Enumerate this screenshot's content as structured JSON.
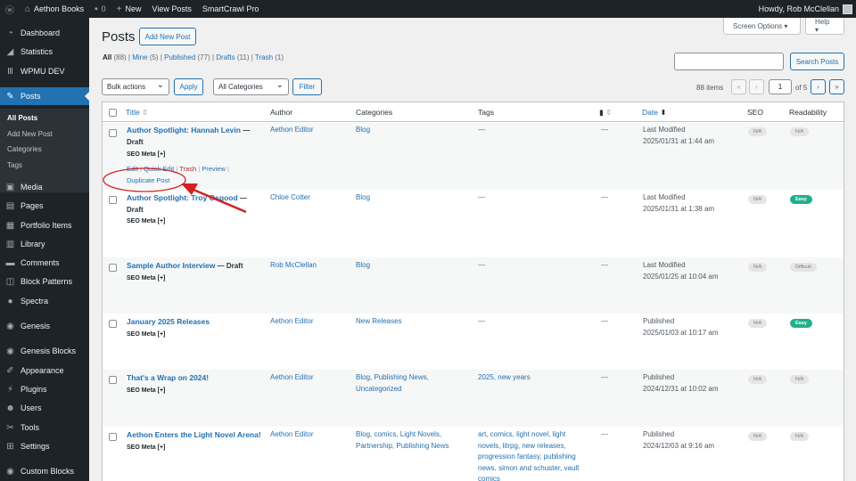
{
  "adminbar": {
    "site_name": "Aethon Books",
    "comments_count": "0",
    "new_label": "New",
    "view_posts_label": "View Posts",
    "smartcrawl_label": "SmartCrawl Pro",
    "howdy": "Howdy, Rob McClellan"
  },
  "sidebar": {
    "items": [
      {
        "label": "Dashboard",
        "icon": "dashboard-icon"
      },
      {
        "label": "Statistics",
        "icon": "chart-icon"
      },
      {
        "label": "WPMU DEV",
        "icon": "wpmudev-icon"
      },
      {
        "label": "Posts",
        "icon": "pin-icon"
      },
      {
        "label": "Media",
        "icon": "media-icon"
      },
      {
        "label": "Pages",
        "icon": "pages-icon"
      },
      {
        "label": "Portfolio Items",
        "icon": "portfolio-icon"
      },
      {
        "label": "Library",
        "icon": "library-icon"
      },
      {
        "label": "Comments",
        "icon": "comments-icon"
      },
      {
        "label": "Block Patterns",
        "icon": "patterns-icon"
      },
      {
        "label": "Spectra",
        "icon": "spectra-icon"
      },
      {
        "label": "Genesis",
        "icon": "genesis-icon"
      },
      {
        "label": "Genesis Blocks",
        "icon": "genesis-blocks-icon"
      },
      {
        "label": "Appearance",
        "icon": "brush-icon"
      },
      {
        "label": "Plugins",
        "icon": "plugin-icon"
      },
      {
        "label": "Users",
        "icon": "users-icon"
      },
      {
        "label": "Tools",
        "icon": "wrench-icon"
      },
      {
        "label": "Settings",
        "icon": "settings-icon"
      },
      {
        "label": "Custom Blocks",
        "icon": "custom-blocks-icon"
      }
    ],
    "submenu": [
      "All Posts",
      "Add New Post",
      "Categories",
      "Tags"
    ]
  },
  "header": {
    "title": "Posts",
    "add_new": "Add New Post",
    "screen_options": "Screen Options ▾",
    "help": "Help ▾"
  },
  "filters": {
    "all": "All",
    "all_count": "(88)",
    "mine": "Mine",
    "mine_count": "(5)",
    "published": "Published",
    "published_count": "(77)",
    "drafts": "Drafts",
    "drafts_count": "(11)",
    "trash": "Trash",
    "trash_count": "(1)",
    "search_button": "Search Posts",
    "search_value": ""
  },
  "tablenav": {
    "bulk_actions": "Bulk actions",
    "apply": "Apply",
    "categories": "All Categories",
    "filter": "Filter",
    "items": "88 items",
    "first": "«",
    "prev": "‹",
    "page": "1",
    "of_pages": "of 5",
    "next": "›",
    "last": "»"
  },
  "columns": {
    "title": "Title",
    "author": "Author",
    "categories": "Categories",
    "tags": "Tags",
    "date": "Date",
    "seo": "SEO",
    "readability": "Readability"
  },
  "seo_meta_label": "SEO Meta [+]",
  "row_actions": {
    "edit": "Edit",
    "quick_edit": "Quick Edit",
    "trash": "Trash",
    "preview": "Preview",
    "duplicate": "Duplicate Post"
  },
  "posts": [
    {
      "title": "Author Spotlight: Hannah Levin",
      "state": "Draft",
      "author": "Aethon Editor",
      "categories": "Blog",
      "tags": "—",
      "comments": "—",
      "date_status": "Last Modified",
      "date": "2025/01/31 at 1:44 am",
      "seo": "N/A",
      "readability": "N/A"
    },
    {
      "title": "Author Spotlight: Troy Osgood",
      "state": "Draft",
      "author": "Chloe Cotter",
      "categories": "Blog",
      "tags": "—",
      "comments": "—",
      "date_status": "Last Modified",
      "date": "2025/01/31 at 1:38 am",
      "seo": "N/A",
      "readability": "Easy"
    },
    {
      "title": "Sample Author Interview",
      "state": "Draft",
      "author": "Rob McClellan",
      "categories": "Blog",
      "tags": "—",
      "comments": "—",
      "date_status": "Last Modified",
      "date": "2025/01/25 at 10:04 am",
      "seo": "N/A",
      "readability": "Difficult"
    },
    {
      "title": "January 2025 Releases",
      "state": "",
      "author": "Aethon Editor",
      "categories": "New Releases",
      "tags": "—",
      "comments": "—",
      "date_status": "Published",
      "date": "2025/01/03 at 10:17 am",
      "seo": "N/A",
      "readability": "Easy"
    },
    {
      "title": "That's a Wrap on 2024!",
      "state": "",
      "author": "Aethon Editor",
      "categories": "Blog, Publishing News, Uncategorized",
      "tags": "2025, new years",
      "comments": "—",
      "date_status": "Published",
      "date": "2024/12/31 at 10:02 am",
      "seo": "N/A",
      "readability": "N/A"
    },
    {
      "title": "Aethon Enters the Light Novel Arena!",
      "state": "",
      "author": "Aethon Editor",
      "categories": "Blog, comics, Light Novels, Partnership, Publishing News",
      "tags": "art, comics, light novel, light novels, litrpg, new releases, progression fantasy, publishing news, simon and schuster, vault comics",
      "comments": "—",
      "date_status": "Published",
      "date": "2024/12/03 at 9:16 am",
      "seo": "N/A",
      "readability": "N/A"
    }
  ],
  "colors": {
    "adminbar": "#1d2327",
    "accent": "#2271b1",
    "easy": "#1fb18a",
    "annotation": "#d42020"
  }
}
